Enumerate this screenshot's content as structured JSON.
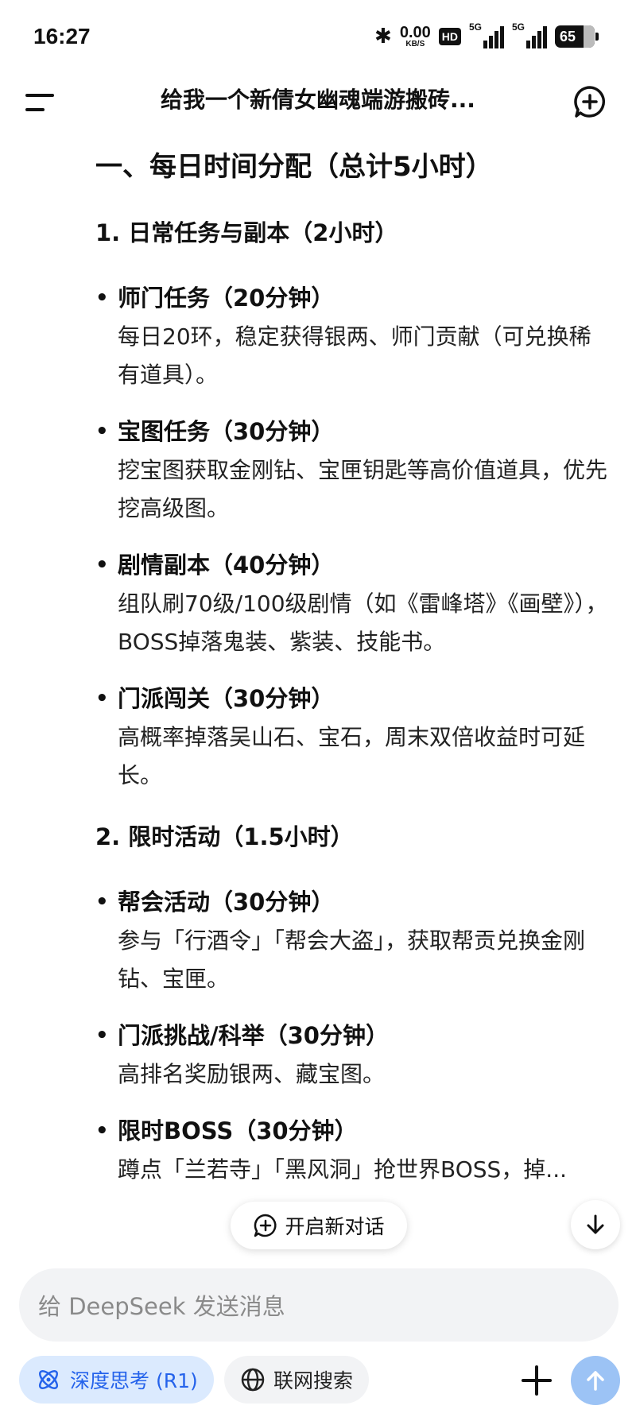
{
  "status_bar": {
    "time": "16:27",
    "net_speed_value": "0.00",
    "net_speed_unit": "KB/S",
    "hd_badge": "HD",
    "signal1_label": "5G",
    "signal2_label": "5G",
    "battery": "65"
  },
  "header": {
    "title": "给我一个新倩女幽魂端游搬砖..."
  },
  "content": {
    "heading": "一、每日时间分配（总计5小时）",
    "sections": [
      {
        "title": "1. 日常任务与副本（2小时）",
        "items": [
          {
            "title": "师门任务（20分钟）",
            "desc": "每日20环，稳定获得银两、师门贡献（可兑换稀有道具）。"
          },
          {
            "title": "宝图任务（30分钟）",
            "desc": "挖宝图获取金刚钻、宝匣钥匙等高价值道具，优先挖高级图。"
          },
          {
            "title": "剧情副本（40分钟）",
            "desc": "组队刷70级/100级剧情（如《雷峰塔》《画壁》），BOSS掉落鬼装、紫装、技能书。"
          },
          {
            "title": "门派闯关（30分钟）",
            "desc": "高概率掉落吴山石、宝石，周末双倍收益时可延长。"
          }
        ]
      },
      {
        "title": "2. 限时活动（1.5小时）",
        "items": [
          {
            "title": "帮会活动（30分钟）",
            "desc": "参与「行酒令」「帮会大盗」，获取帮贡兑换金刚钻、宝匣。"
          },
          {
            "title": "门派挑战/科举（30分钟）",
            "desc": "高排名奖励银两、藏宝图。"
          },
          {
            "title": "限时BOSS（30分钟）",
            "desc": "蹲点「兰若寺」「黑风洞」抢世界BOSS，掉..."
          }
        ]
      }
    ]
  },
  "floating": {
    "new_dialog_label": "开启新对话"
  },
  "input": {
    "placeholder": "给 DeepSeek 发送消息"
  },
  "bottom_bar": {
    "deep_think_label": "深度思考 (R1)",
    "web_search_label": "联网搜索"
  },
  "colors": {
    "accent": "#2563eb",
    "deep_think_bg": "#dbeafe",
    "send_button": "#9cc3f5",
    "input_bg": "#f2f3f5"
  }
}
